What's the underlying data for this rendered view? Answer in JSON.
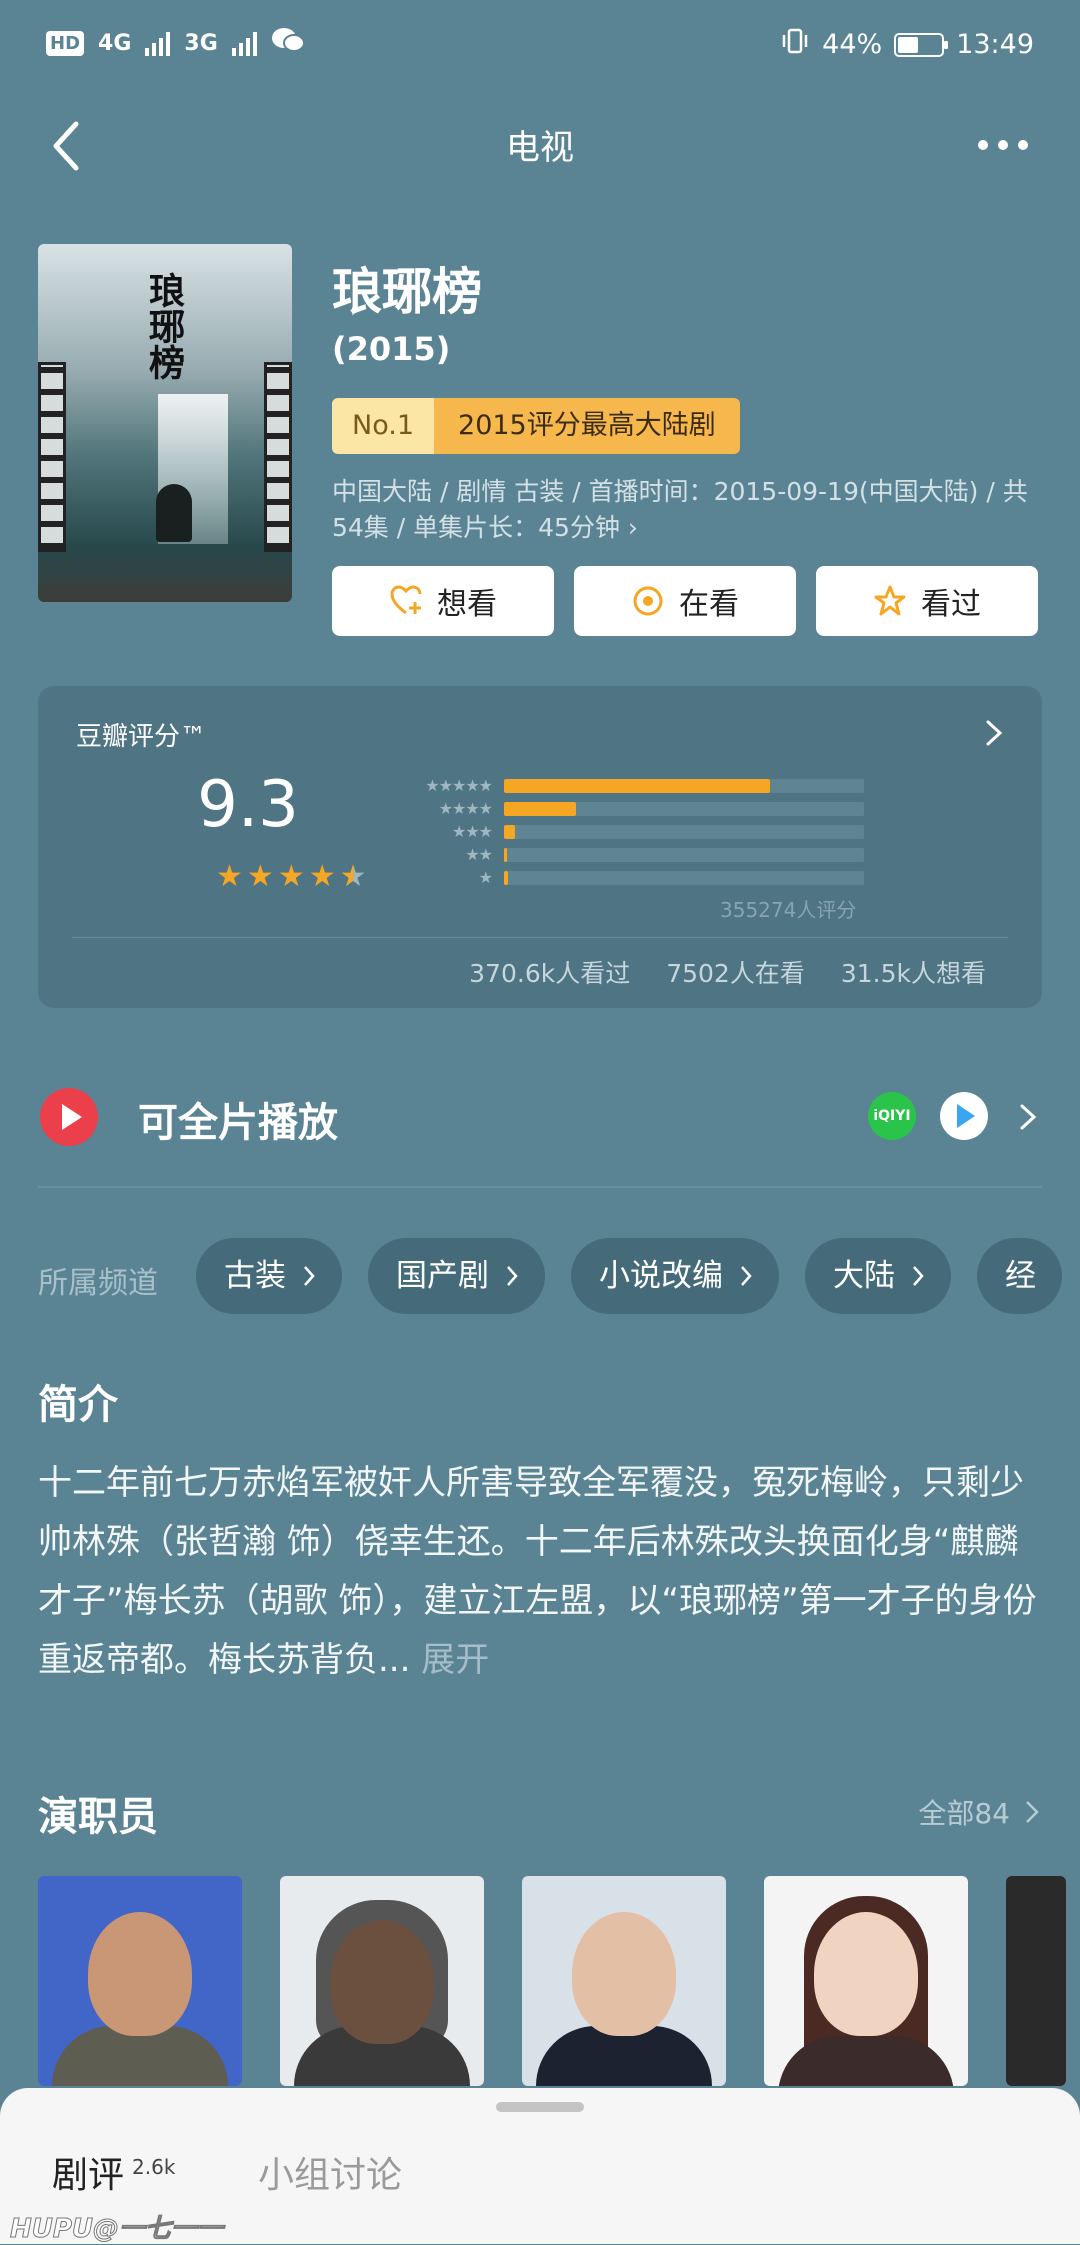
{
  "status_bar": {
    "hd": "HD",
    "net1": "4G",
    "net2": "3G",
    "battery_pct": "44%",
    "battery_level": 0.44,
    "time": "13:49"
  },
  "nav": {
    "title": "电视"
  },
  "movie": {
    "poster_title": "琅琊榜",
    "title": "琅琊榜",
    "year": "(2015)",
    "badge_no": "No.1",
    "badge_text": "2015评分最高大陆剧",
    "meta": "中国大陆 / 剧情 古装 / 首播时间：2015-09-19(中国大陆) / 共54集 / 单集片长：45分钟 ›"
  },
  "actions": [
    {
      "label": "想看",
      "icon": "heart-plus-icon"
    },
    {
      "label": "在看",
      "icon": "target-icon"
    },
    {
      "label": "看过",
      "icon": "star-outline-icon"
    }
  ],
  "rating": {
    "label": "豆瓣评分™",
    "score": "9.3",
    "stars": 4.5,
    "distribution": [
      {
        "stars": "★★★★★",
        "fraction": 0.74
      },
      {
        "stars": "★★★★",
        "fraction": 0.2
      },
      {
        "stars": "★★★",
        "fraction": 0.03
      },
      {
        "stars": "★★",
        "fraction": 0.006
      },
      {
        "stars": "★",
        "fraction": 0.012
      }
    ],
    "count": "355274人评分",
    "watched": "370.6k人看过",
    "watching": "7502人在看",
    "want": "31.5k人想看"
  },
  "play": {
    "title": "可全片播放",
    "iqiyi": "iQIYI"
  },
  "channels": {
    "label": "所属频道",
    "items": [
      "古装",
      "国产剧",
      "小说改编",
      "大陆",
      "经"
    ]
  },
  "intro": {
    "heading": "简介",
    "text": "十二年前七万赤焰军被奸人所害导致全军覆没，冤死梅岭，只剩少帅林殊（张哲瀚 饰）侥幸生还。十二年后林殊改头换面化身“麒麟才子”梅长苏（胡歌 饰），建立江左盟，以“琅琊榜”第一才子的身份重返帝都。梅长苏背负...",
    "more": "展开"
  },
  "cast": {
    "heading": "演职员",
    "all": "全部84"
  },
  "sheet": {
    "tab1": "剧评",
    "tab1_count": "2.6k",
    "tab2": "小组讨论",
    "watermark": "HUPU@一七一一"
  }
}
